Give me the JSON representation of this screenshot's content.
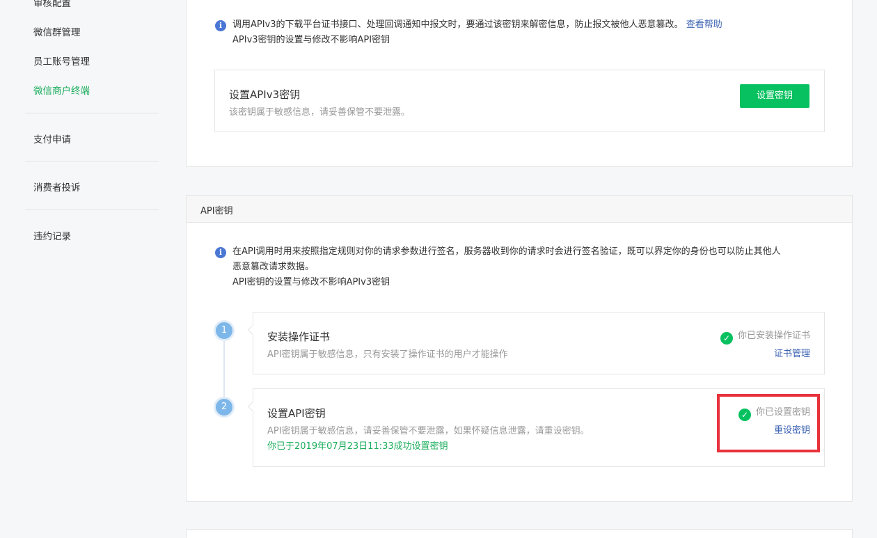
{
  "sidebar": {
    "items": [
      {
        "label": "审核配置",
        "active": false
      },
      {
        "label": "微信群管理",
        "active": false
      },
      {
        "label": "员工账号管理",
        "active": false
      },
      {
        "label": "微信商户终端",
        "active": true
      },
      {
        "label": "支付申请",
        "active": false
      },
      {
        "label": "消费者投诉",
        "active": false
      },
      {
        "label": "违约记录",
        "active": false
      }
    ]
  },
  "apiv3": {
    "info_line1": "调用APIv3的下载平台证书接口、处理回调通知中报文时，要通过该密钥来解密信息，防止报文被他人恶意篡改。",
    "help_link": "查看帮助",
    "info_line2": "APIv3密钥的设置与修改不影响API密钥",
    "card_title": "设置APIv3密钥",
    "card_desc": "该密钥属于敏感信息，请妥善保管不要泄露。",
    "button": "设置密钥"
  },
  "api_key": {
    "header": "API密钥",
    "info_line1": "在API调用时用来按照指定规则对你的请求参数进行签名，服务器收到你的请求时会进行签名验证，既可以界定你的身份也可以防止其他人",
    "info_line2": "恶意篡改请求数据。",
    "info_line3": "API密钥的设置与修改不影响APIv3密钥",
    "steps": [
      {
        "number": "1",
        "title": "安装操作证书",
        "desc": "API密钥属于敏感信息，只有安装了操作证书的用户才能操作",
        "status": "你已安装操作证书",
        "action": "证书管理"
      },
      {
        "number": "2",
        "title": "设置API密钥",
        "desc": "API密钥属于敏感信息，请妥善保管不要泄露，如果怀疑信息泄露，请重设密钥。",
        "success": "你已于2019年07月23日11:33成功设置密钥",
        "status": "你已设置密钥",
        "action": "重设密钥"
      }
    ]
  },
  "icons": {
    "info": "info-icon",
    "check": "check-circle-icon"
  },
  "colors": {
    "brand_green": "#07c160",
    "link_blue": "#3d64b3",
    "highlight_red": "#e8323c"
  }
}
